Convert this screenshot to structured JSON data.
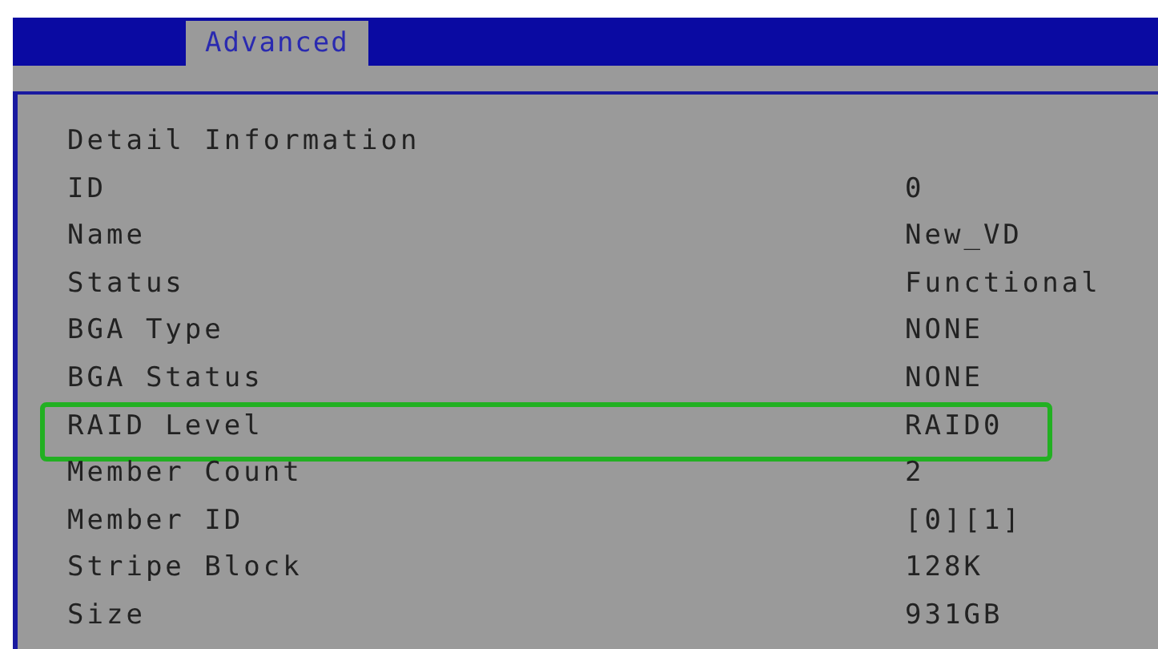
{
  "tabs": [
    {
      "label": "Advanced",
      "selected": true
    }
  ],
  "panel": {
    "heading": "Detail Information",
    "rows": [
      {
        "label": "ID",
        "value": "0",
        "highlighted": false
      },
      {
        "label": "Name",
        "value": "New_VD",
        "highlighted": false
      },
      {
        "label": "Status",
        "value": "Functional",
        "highlighted": false
      },
      {
        "label": "BGA Type",
        "value": "NONE",
        "highlighted": false
      },
      {
        "label": "BGA Status",
        "value": "NONE",
        "highlighted": false
      },
      {
        "label": "RAID Level",
        "value": "RAID0",
        "highlighted": true
      },
      {
        "label": "Member Count",
        "value": "2",
        "highlighted": false
      },
      {
        "label": "Member ID",
        "value": "[0][1]",
        "highlighted": false
      },
      {
        "label": "Stripe Block",
        "value": "128K",
        "highlighted": false
      },
      {
        "label": "Size",
        "value": "931GB",
        "highlighted": false
      }
    ]
  }
}
